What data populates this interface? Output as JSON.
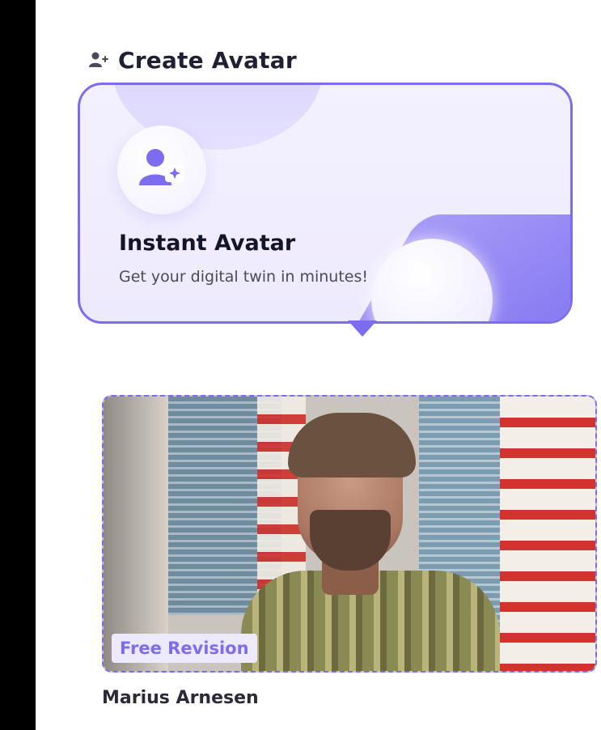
{
  "section": {
    "title": "Create Avatar",
    "icon": "add-user-icon"
  },
  "instant_avatar_card": {
    "title": "Instant Avatar",
    "subtitle": "Get your digital twin in minutes!",
    "icon": "add-user-sparkle-icon",
    "accent_color": "#7c6cf0"
  },
  "avatar_item": {
    "badge": "Free Revision",
    "name": "Marius Arnesen"
  }
}
